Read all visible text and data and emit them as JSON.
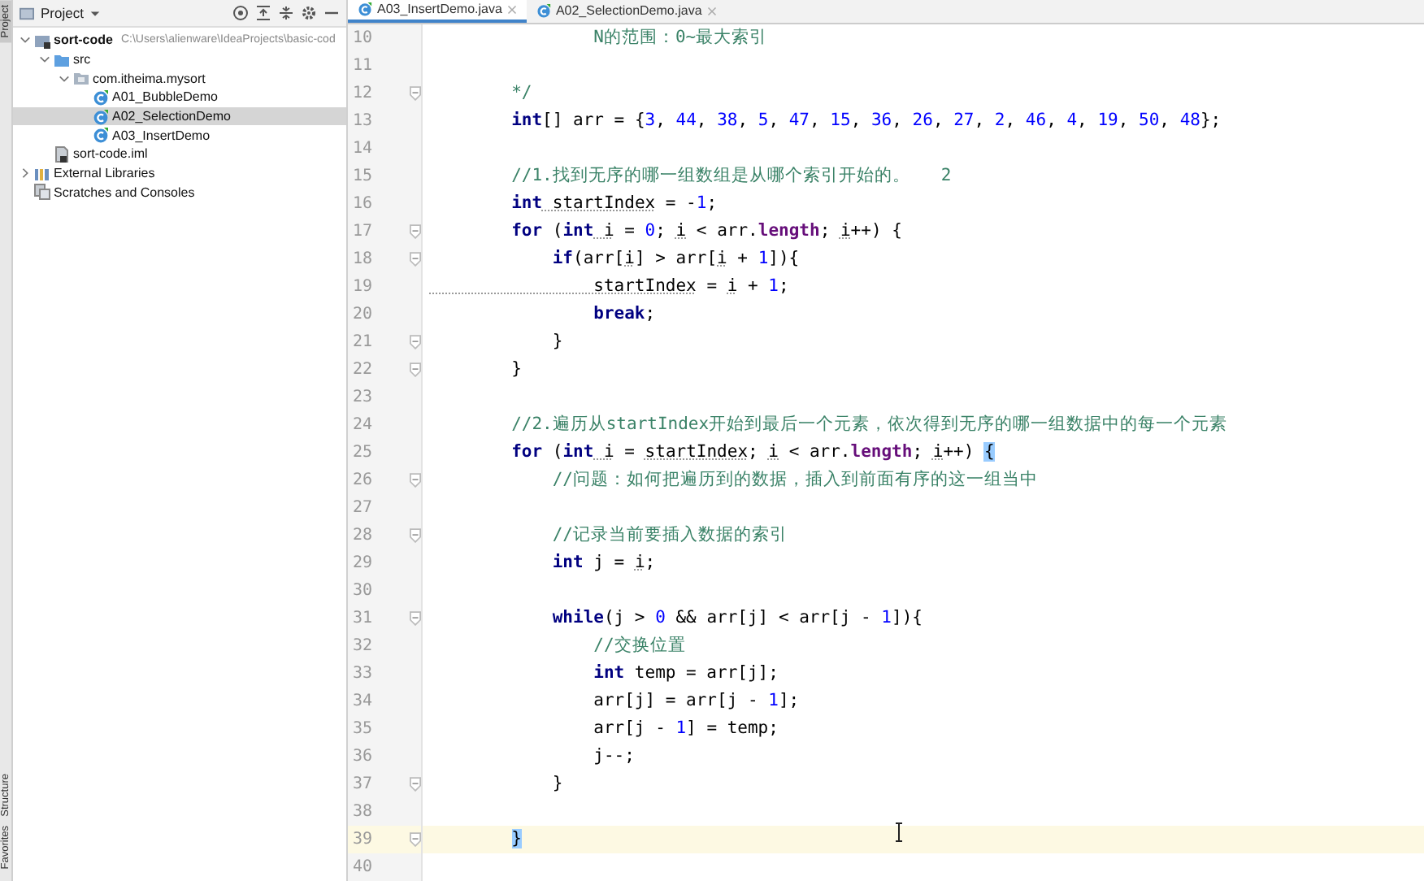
{
  "side_strip": {
    "tabs": [
      {
        "label": "Project",
        "selected": true
      },
      {
        "label": "Structure",
        "selected": false
      },
      {
        "label": "Favorites",
        "selected": false
      }
    ]
  },
  "project_panel": {
    "title": "Project",
    "tree": [
      {
        "label": "sort-code",
        "path": "C:\\Users\\alienware\\IdeaProjects\\basic-cod",
        "kind": "module",
        "expanded": true,
        "selected": false,
        "children": [
          {
            "label": "src",
            "kind": "folder",
            "expanded": true,
            "selected": false,
            "children": [
              {
                "label": "com.itheima.mysort",
                "kind": "package",
                "expanded": true,
                "selected": false,
                "children": [
                  {
                    "label": "A01_BubbleDemo",
                    "kind": "class",
                    "selected": false
                  },
                  {
                    "label": "A02_SelectionDemo",
                    "kind": "class",
                    "selected": true
                  },
                  {
                    "label": "A03_InsertDemo",
                    "kind": "class",
                    "selected": false
                  }
                ]
              }
            ]
          },
          {
            "label": "sort-code.iml",
            "kind": "iml",
            "selected": false
          }
        ]
      },
      {
        "label": "External Libraries",
        "kind": "libraries",
        "expanded": false,
        "selected": false
      },
      {
        "label": "Scratches and Consoles",
        "kind": "scratches",
        "selected": false
      }
    ]
  },
  "editor": {
    "tabs": [
      {
        "label": "A03_InsertDemo.java",
        "selected": true
      },
      {
        "label": "A02_SelectionDemo.java",
        "selected": false
      }
    ],
    "lines": [
      {
        "number": "10",
        "fold": false,
        "current": false,
        "tokens": [
          {
            "kind": "cm",
            "t": "                N的范围：0~最大索引"
          }
        ]
      },
      {
        "number": "11",
        "fold": false,
        "current": false
      },
      {
        "number": "12",
        "fold": true,
        "current": false,
        "tokens": [
          {
            "kind": "cm",
            "t": "        */"
          }
        ]
      },
      {
        "number": "13",
        "fold": false,
        "current": false,
        "tokens": [
          {
            "kind": "kw",
            "t": "        int"
          },
          {
            "kind": "p",
            "t": "[] arr = {"
          },
          {
            "kind": "num",
            "t": "3"
          },
          {
            "kind": "p",
            "t": ", "
          },
          {
            "kind": "num",
            "t": "44"
          },
          {
            "kind": "p",
            "t": ", "
          },
          {
            "kind": "num",
            "t": "38"
          },
          {
            "kind": "p",
            "t": ", "
          },
          {
            "kind": "num",
            "t": "5"
          },
          {
            "kind": "p",
            "t": ", "
          },
          {
            "kind": "num",
            "t": "47"
          },
          {
            "kind": "p",
            "t": ", "
          },
          {
            "kind": "num",
            "t": "15"
          },
          {
            "kind": "p",
            "t": ", "
          },
          {
            "kind": "num",
            "t": "36"
          },
          {
            "kind": "p",
            "t": ", "
          },
          {
            "kind": "num",
            "t": "26"
          },
          {
            "kind": "p",
            "t": ", "
          },
          {
            "kind": "num",
            "t": "27"
          },
          {
            "kind": "p",
            "t": ", "
          },
          {
            "kind": "num",
            "t": "2"
          },
          {
            "kind": "p",
            "t": ", "
          },
          {
            "kind": "num",
            "t": "46"
          },
          {
            "kind": "p",
            "t": ", "
          },
          {
            "kind": "num",
            "t": "4"
          },
          {
            "kind": "p",
            "t": ", "
          },
          {
            "kind": "num",
            "t": "19"
          },
          {
            "kind": "p",
            "t": ", "
          },
          {
            "kind": "num",
            "t": "50"
          },
          {
            "kind": "p",
            "t": ", "
          },
          {
            "kind": "num",
            "t": "48"
          },
          {
            "kind": "p",
            "t": "};"
          }
        ]
      },
      {
        "number": "14",
        "fold": false,
        "current": false
      },
      {
        "number": "15",
        "fold": false,
        "current": false,
        "tokens": [
          {
            "kind": "cm",
            "t": "        //1.找到无序的哪一组数组是从哪个索引开始的。   2"
          }
        ]
      },
      {
        "number": "16",
        "fold": false,
        "current": false,
        "tokens": [
          {
            "kind": "kw",
            "t": "        int"
          },
          {
            "kind": "var",
            "t": " startIndex"
          },
          {
            "kind": "p",
            "t": " = -"
          },
          {
            "kind": "num",
            "t": "1"
          },
          {
            "kind": "p",
            "t": ";"
          }
        ]
      },
      {
        "number": "17",
        "fold": true,
        "current": false,
        "tokens": [
          {
            "kind": "kw",
            "t": "        for"
          },
          {
            "kind": "p",
            "t": " ("
          },
          {
            "kind": "kw",
            "t": "int"
          },
          {
            "kind": "var",
            "t": " i"
          },
          {
            "kind": "p",
            "t": " = "
          },
          {
            "kind": "num",
            "t": "0"
          },
          {
            "kind": "p",
            "t": "; "
          },
          {
            "kind": "var",
            "t": "i"
          },
          {
            "kind": "p",
            "t": " < arr."
          },
          {
            "kind": "fld",
            "t": "length"
          },
          {
            "kind": "p",
            "t": "; "
          },
          {
            "kind": "var",
            "t": "i"
          },
          {
            "kind": "p",
            "t": "++) {"
          }
        ]
      },
      {
        "number": "18",
        "fold": true,
        "current": false,
        "tokens": [
          {
            "kind": "kw",
            "t": "            if"
          },
          {
            "kind": "p",
            "t": "(arr["
          },
          {
            "kind": "var",
            "t": "i"
          },
          {
            "kind": "p",
            "t": "] > arr["
          },
          {
            "kind": "var",
            "t": "i"
          },
          {
            "kind": "p",
            "t": " + "
          },
          {
            "kind": "num",
            "t": "1"
          },
          {
            "kind": "p",
            "t": "]){"
          }
        ]
      },
      {
        "number": "19",
        "fold": false,
        "current": false,
        "tokens": [
          {
            "kind": "var",
            "t": "                startIndex"
          },
          {
            "kind": "p",
            "t": " = "
          },
          {
            "kind": "var",
            "t": "i"
          },
          {
            "kind": "p",
            "t": " + "
          },
          {
            "kind": "num",
            "t": "1"
          },
          {
            "kind": "p",
            "t": ";"
          }
        ]
      },
      {
        "number": "20",
        "fold": false,
        "current": false,
        "tokens": [
          {
            "kind": "kw",
            "t": "                break"
          },
          {
            "kind": "p",
            "t": ";"
          }
        ]
      },
      {
        "number": "21",
        "fold": true,
        "current": false,
        "tokens": [
          {
            "kind": "p",
            "t": "            }"
          }
        ]
      },
      {
        "number": "22",
        "fold": true,
        "current": false,
        "tokens": [
          {
            "kind": "p",
            "t": "        }"
          }
        ]
      },
      {
        "number": "23",
        "fold": false,
        "current": false
      },
      {
        "number": "24",
        "fold": false,
        "current": false,
        "tokens": [
          {
            "kind": "cm",
            "t": "        //2.遍历从startIndex开始到最后一个元素，依次得到无序的哪一组数据中的每一个元素"
          }
        ]
      },
      {
        "number": "25",
        "fold": false,
        "current": false,
        "tokens": [
          {
            "kind": "kw",
            "t": "        for"
          },
          {
            "kind": "p",
            "t": " ("
          },
          {
            "kind": "kw",
            "t": "int"
          },
          {
            "kind": "var",
            "t": " i"
          },
          {
            "kind": "p",
            "t": " = "
          },
          {
            "kind": "var",
            "t": "startIndex"
          },
          {
            "kind": "p",
            "t": "; "
          },
          {
            "kind": "var",
            "t": "i"
          },
          {
            "kind": "p",
            "t": " < arr."
          },
          {
            "kind": "fld",
            "t": "length"
          },
          {
            "kind": "p",
            "t": "; "
          },
          {
            "kind": "var",
            "t": "i"
          },
          {
            "kind": "p",
            "t": "++) "
          },
          {
            "kind": "match",
            "t": "{"
          }
        ]
      },
      {
        "number": "26",
        "fold": true,
        "current": false,
        "tokens": [
          {
            "kind": "cm",
            "t": "            //问题：如何把遍历到的数据，插入到前面有序的这一组当中"
          }
        ]
      },
      {
        "number": "27",
        "fold": false,
        "current": false
      },
      {
        "number": "28",
        "fold": true,
        "current": false,
        "tokens": [
          {
            "kind": "cm",
            "t": "            //记录当前要插入数据的索引"
          }
        ]
      },
      {
        "number": "29",
        "fold": false,
        "current": false,
        "tokens": [
          {
            "kind": "kw",
            "t": "            int"
          },
          {
            "kind": "p",
            "t": " j = "
          },
          {
            "kind": "var",
            "t": "i"
          },
          {
            "kind": "p",
            "t": ";"
          }
        ]
      },
      {
        "number": "30",
        "fold": false,
        "current": false
      },
      {
        "number": "31",
        "fold": true,
        "current": false,
        "tokens": [
          {
            "kind": "kw",
            "t": "            while"
          },
          {
            "kind": "p",
            "t": "(j > "
          },
          {
            "kind": "num",
            "t": "0"
          },
          {
            "kind": "p",
            "t": " && arr[j] < arr[j - "
          },
          {
            "kind": "num",
            "t": "1"
          },
          {
            "kind": "p",
            "t": "]){"
          }
        ]
      },
      {
        "number": "32",
        "fold": false,
        "current": false,
        "tokens": [
          {
            "kind": "cm",
            "t": "                //交换位置"
          }
        ]
      },
      {
        "number": "33",
        "fold": false,
        "current": false,
        "tokens": [
          {
            "kind": "kw",
            "t": "                int"
          },
          {
            "kind": "p",
            "t": " temp = arr[j];"
          }
        ]
      },
      {
        "number": "34",
        "fold": false,
        "current": false,
        "tokens": [
          {
            "kind": "p",
            "t": "                arr[j] = arr[j - "
          },
          {
            "kind": "num",
            "t": "1"
          },
          {
            "kind": "p",
            "t": "];"
          }
        ]
      },
      {
        "number": "35",
        "fold": false,
        "current": false,
        "tokens": [
          {
            "kind": "p",
            "t": "                arr[j - "
          },
          {
            "kind": "num",
            "t": "1"
          },
          {
            "kind": "p",
            "t": "] = temp;"
          }
        ]
      },
      {
        "number": "36",
        "fold": false,
        "current": false,
        "tokens": [
          {
            "kind": "p",
            "t": "                j--;"
          }
        ]
      },
      {
        "number": "37",
        "fold": true,
        "current": false,
        "tokens": [
          {
            "kind": "p",
            "t": "            }"
          }
        ]
      },
      {
        "number": "38",
        "fold": false,
        "current": false
      },
      {
        "number": "39",
        "fold": true,
        "current": true,
        "tokens": [
          {
            "kind": "match",
            "t": "        }"
          }
        ]
      },
      {
        "number": "40",
        "fold": false,
        "current": false
      }
    ]
  }
}
